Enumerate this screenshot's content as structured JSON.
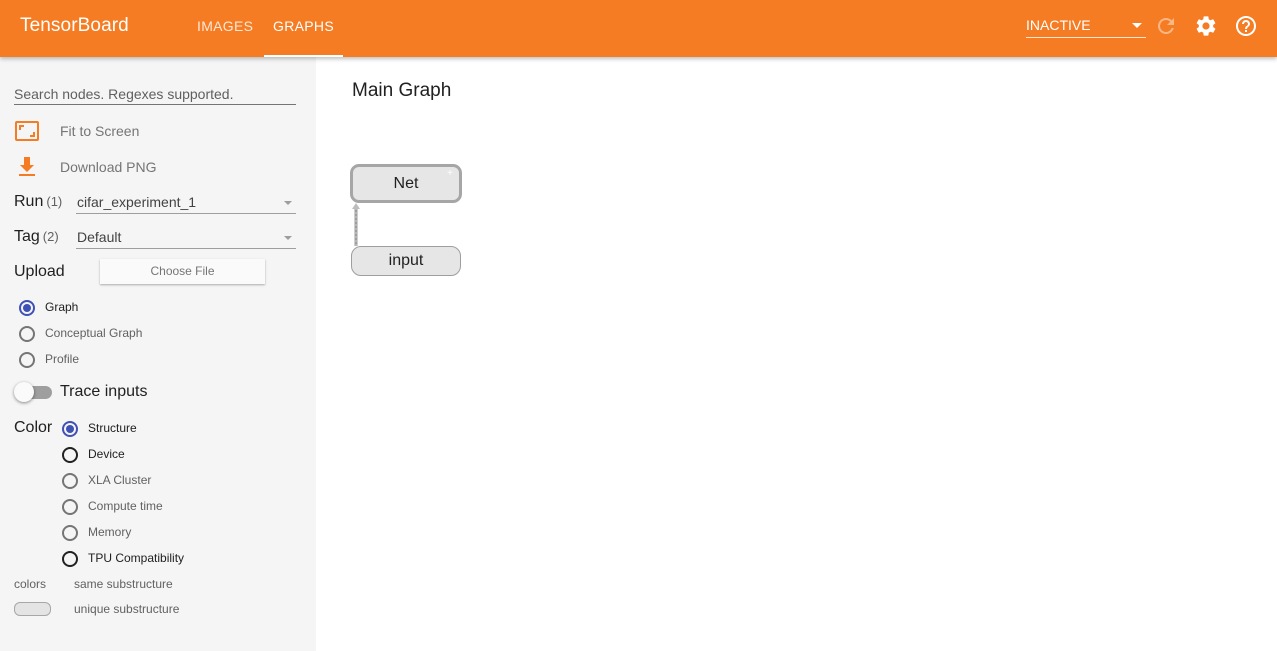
{
  "header": {
    "brand": "TensorBoard",
    "tabs": [
      {
        "label": "IMAGES",
        "active": false
      },
      {
        "label": "GRAPHS",
        "active": true
      }
    ],
    "status_select": "INACTIVE",
    "icons": [
      "reload-icon",
      "settings-icon",
      "help-icon"
    ],
    "accent_color": "#f57c22"
  },
  "sidebar": {
    "search_placeholder": "Search nodes. Regexes supported.",
    "fit_label": "Fit to Screen",
    "download_label": "Download PNG",
    "run": {
      "label": "Run",
      "count": "(1)",
      "value": "cifar_experiment_1"
    },
    "tag": {
      "label": "Tag",
      "count": "(2)",
      "value": "Default"
    },
    "upload": {
      "label": "Upload",
      "button": "Choose File"
    },
    "graph_types": [
      {
        "label": "Graph",
        "selected": true
      },
      {
        "label": "Conceptual Graph",
        "selected": false
      },
      {
        "label": "Profile",
        "selected": false
      }
    ],
    "trace_inputs": {
      "label": "Trace inputs",
      "on": false
    },
    "color": {
      "label": "Color",
      "options": [
        {
          "label": "Structure",
          "selected": true
        },
        {
          "label": "Device",
          "selected": false
        },
        {
          "label": "XLA Cluster",
          "selected": false
        },
        {
          "label": "Compute time",
          "selected": false
        },
        {
          "label": "Memory",
          "selected": false
        },
        {
          "label": "TPU Compatibility",
          "selected": false
        }
      ]
    },
    "legend": {
      "colors_label": "colors",
      "same_label": "same substructure",
      "unique_label": "unique substructure"
    }
  },
  "main": {
    "title": "Main Graph",
    "nodes": {
      "net": "Net",
      "input": "input"
    }
  }
}
